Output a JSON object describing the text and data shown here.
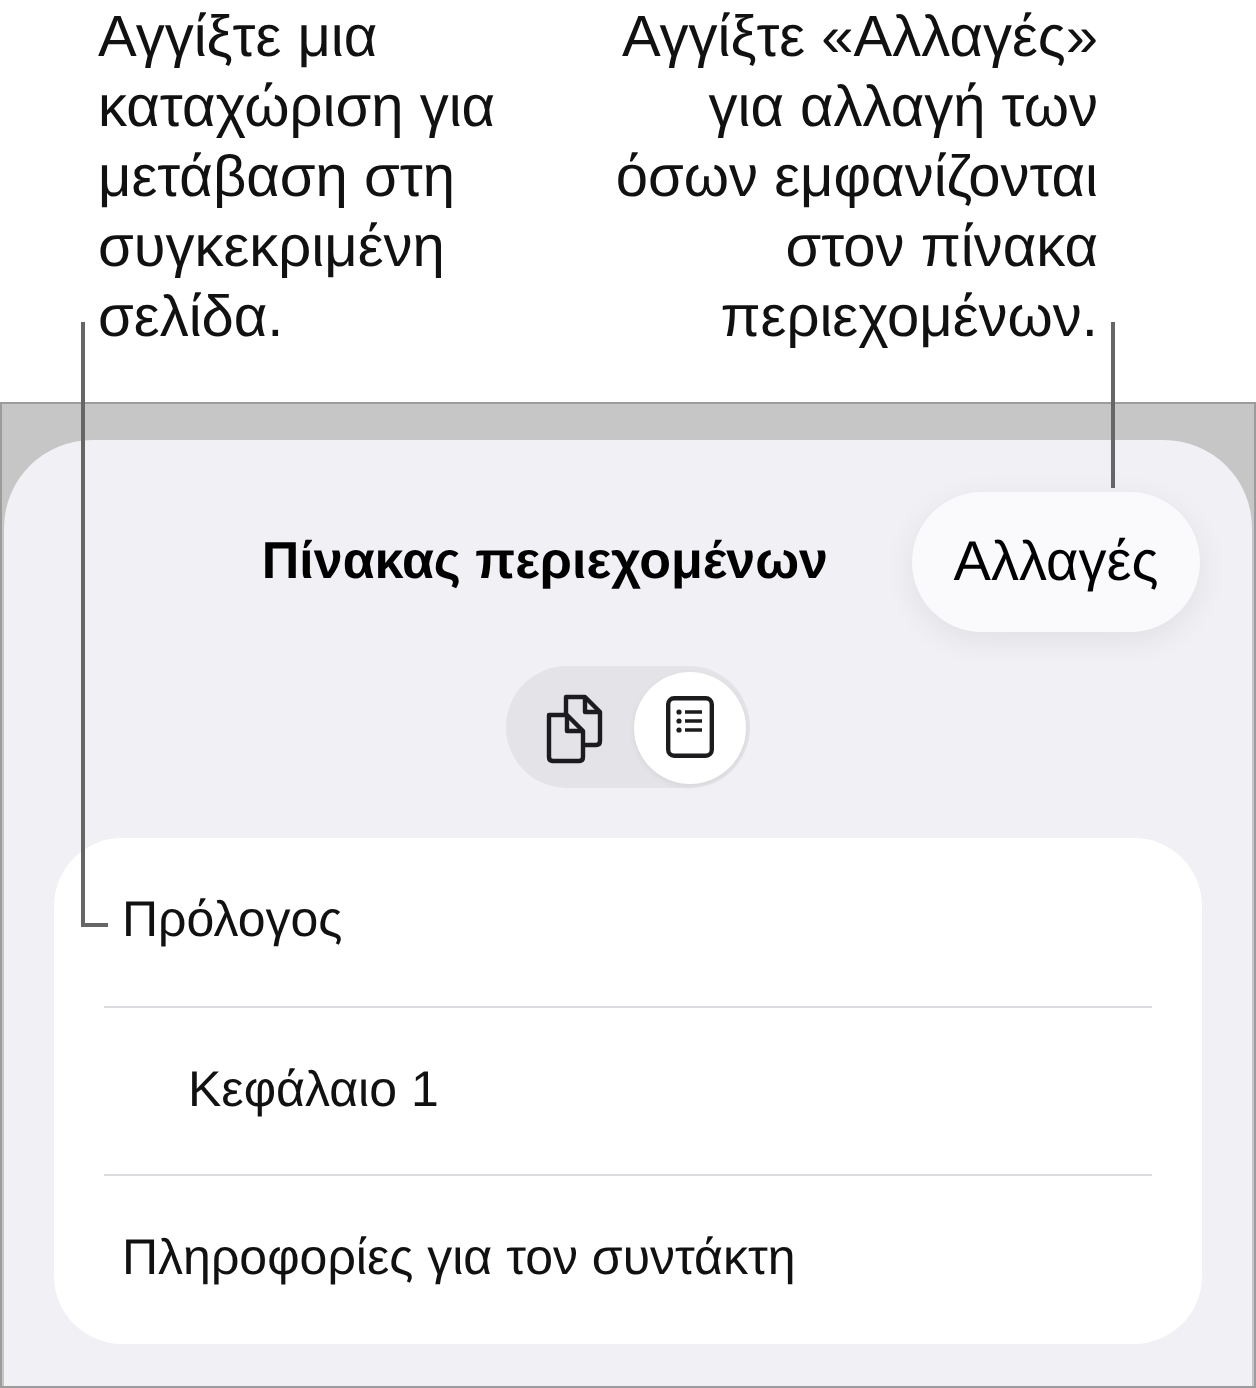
{
  "callouts": [
    {
      "text": "Αγγίξτε μια\nκαταχώριση για\nμετάβαση στη\nσυγκεκριμένη\nσελίδα.",
      "kind": "left"
    },
    {
      "text": "Αγγίξτε «Αλλαγές»\nγια αλλαγή των\nόσων εμφανίζονται\nστον πίνακα\nπεριεχομένων.",
      "kind": "right"
    }
  ],
  "sheet": {
    "title": "Πίνακας περιεχομένων",
    "edit_button": "Αλλαγές"
  },
  "view_switcher": [
    {
      "kind": "pages",
      "selected": false
    },
    {
      "kind": "outline",
      "selected": true
    }
  ],
  "entries": [
    {
      "label": "Πρόλογος",
      "children": [
        {
          "label": "Κεφάλαιο 1"
        }
      ]
    },
    {
      "label": "Πληροφορίες για τον συντάκτη"
    }
  ]
}
